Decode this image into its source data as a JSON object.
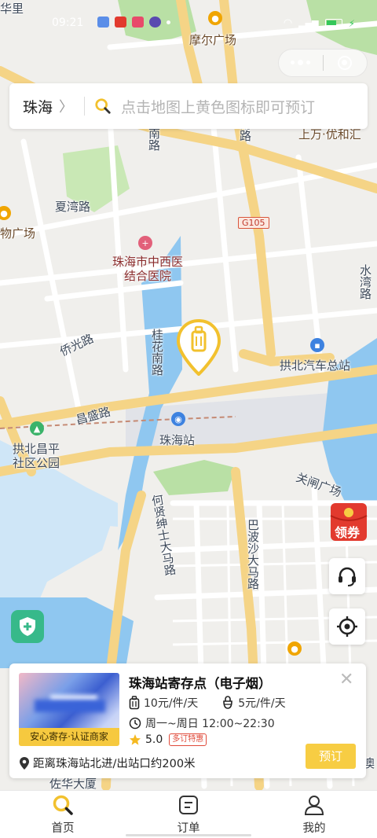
{
  "status_bar": {
    "time": "09:21"
  },
  "map": {
    "labels": {
      "huali": "华里",
      "moer_plaza": "摩尔广场",
      "nan_road": "南路",
      "nan_road_2": "南路",
      "lu": "路",
      "shangwan": "上万·优和汇",
      "xiawan_road": "夏湾路",
      "wu_plaza": "物广场",
      "hospital": "珠海市中西医结合医院",
      "qiaoguang_road": "侨光路",
      "guihua_road": "桂花南路",
      "gongbei_bus": "拱北汽车总站",
      "changsheng_road": "昌盛路",
      "zhuhai_station": "珠海站",
      "gongbei_park": "拱北昌平社区公园",
      "guanzha_plaza": "关闸广场",
      "bobosha_road": "巴波沙大马路",
      "hexian_road": "何贤绅士大马路",
      "shuiwan_road": "水湾路",
      "zuohua_building": "佐华大厦",
      "ao": "澳"
    },
    "road_sign": "G105"
  },
  "search": {
    "city": "珠海",
    "chevron": "〉",
    "placeholder": "点击地图上黄色图标即可预订"
  },
  "floating": {
    "coupon_label": "领券"
  },
  "store_card": {
    "certification": "安心寄存·认证商家",
    "name": "珠海站寄存点（电子烟）",
    "price_luggage": "10元/件/天",
    "price_bag": "5元/件/天",
    "hours": "周一~周日 12:00~22:30",
    "rating": "5.0",
    "promo_badge": "多订特惠",
    "distance": "距离珠海站北进/出站口约200米",
    "book_button": "预订",
    "close": "✕"
  },
  "tabs": [
    {
      "label": "首页",
      "icon": "search-icon",
      "active": true
    },
    {
      "label": "订单",
      "icon": "order-icon",
      "active": false
    },
    {
      "label": "我的",
      "icon": "user-icon",
      "active": false
    }
  ],
  "colors": {
    "accent": "#f7cd43",
    "road_major": "#f5d486",
    "water": "#8fc7f0",
    "park": "#b9e0a5",
    "shield": "#37b98a",
    "coupon": "#e23a2e"
  }
}
